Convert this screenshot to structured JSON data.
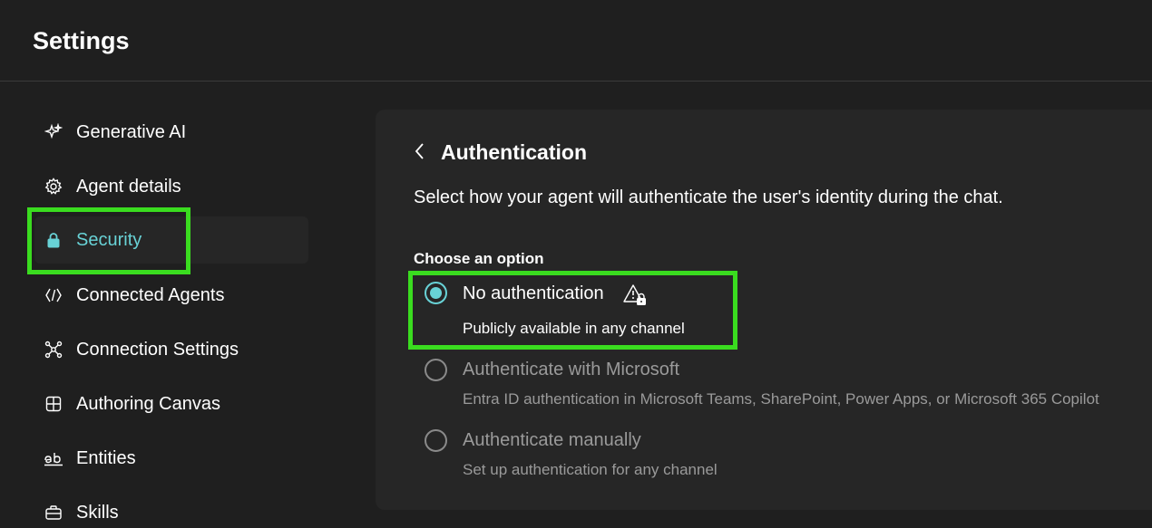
{
  "header": {
    "title": "Settings"
  },
  "sidebar": {
    "items": [
      {
        "label": "Generative AI",
        "icon": "sparkle-icon"
      },
      {
        "label": "Agent details",
        "icon": "gear-icon"
      },
      {
        "label": "Security",
        "icon": "lock-icon",
        "selected": true
      },
      {
        "label": "Connected Agents",
        "icon": "code-icon"
      },
      {
        "label": "Connection Settings",
        "icon": "network-icon"
      },
      {
        "label": "Authoring Canvas",
        "icon": "grid-icon"
      },
      {
        "label": "Entities",
        "icon": "text-ab-icon"
      },
      {
        "label": "Skills",
        "icon": "briefcase-icon"
      }
    ]
  },
  "panel": {
    "title": "Authentication",
    "description": "Select how your agent will authenticate the user's identity during the chat.",
    "choose_label": "Choose an option",
    "options": [
      {
        "label": "No authentication",
        "sub": "Publicly available in any channel",
        "selected": true,
        "icon": "warning-lock-icon"
      },
      {
        "label": "Authenticate with Microsoft",
        "sub": "Entra ID authentication in Microsoft Teams, SharePoint, Power Apps, or Microsoft 365 Copilot",
        "selected": false
      },
      {
        "label": "Authenticate manually",
        "sub": "Set up authentication for any channel",
        "selected": false
      }
    ]
  },
  "colors": {
    "accent": "#68d2d6",
    "highlight": "#3adc1f",
    "background": "#1f1f1f",
    "panel": "#262626"
  }
}
